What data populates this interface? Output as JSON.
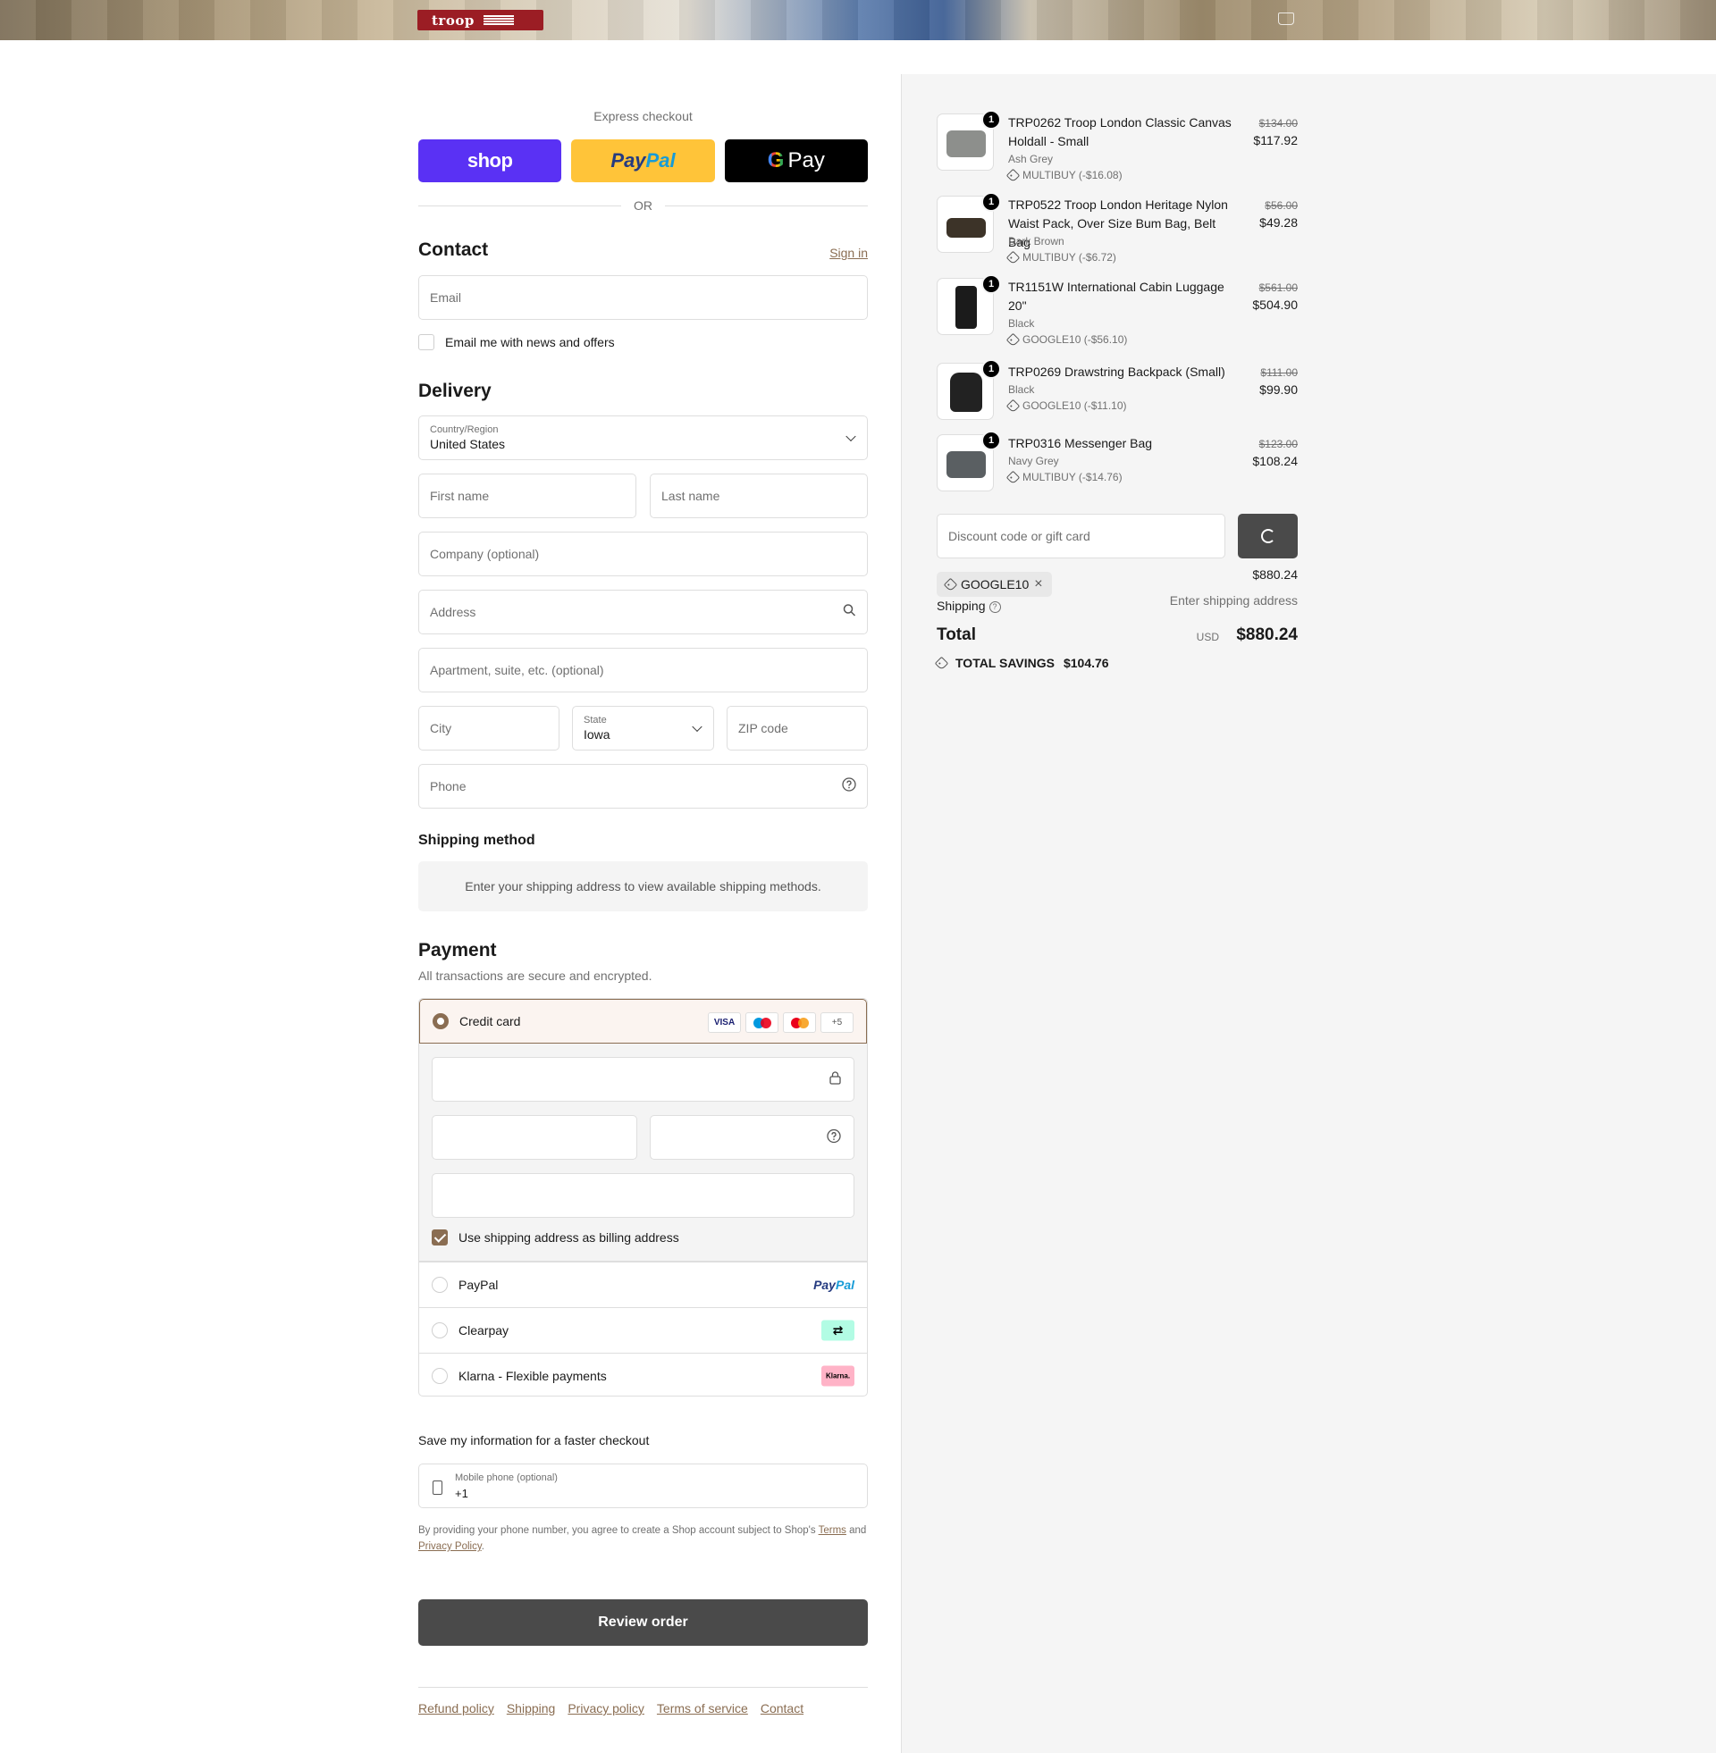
{
  "brand": {
    "logo_text": "troop"
  },
  "express": {
    "title": "Express checkout",
    "shop_label": "shop",
    "paypal_label_1": "Pay",
    "paypal_label_2": "Pal",
    "gpay_g": "G",
    "gpay_label": "Pay",
    "or_label": "OR"
  },
  "contact": {
    "title": "Contact",
    "sign_in": "Sign in",
    "email_placeholder": "Email",
    "news_label": "Email me with news and offers"
  },
  "delivery": {
    "title": "Delivery",
    "country_label": "Country/Region",
    "country_value": "United States",
    "first_name": "First name",
    "last_name": "Last name",
    "company": "Company (optional)",
    "address": "Address",
    "apartment": "Apartment, suite, etc. (optional)",
    "city": "City",
    "state_label": "State",
    "state_value": "Iowa",
    "zip": "ZIP code",
    "phone": "Phone"
  },
  "shipping_method": {
    "title": "Shipping method",
    "notice": "Enter your shipping address to view available shipping methods."
  },
  "payment": {
    "title": "Payment",
    "subtitle": "All transactions are secure and encrypted.",
    "credit_card": "Credit card",
    "brands": {
      "visa": "VISA",
      "more": "+5"
    },
    "billing_label": "Use shipping address as billing address",
    "paypal": "PayPal",
    "paypal_logo_1": "Pay",
    "paypal_logo_2": "Pal",
    "clearpay": "Clearpay",
    "clearpay_logo": "⇄",
    "klarna": "Klarna - Flexible payments",
    "klarna_logo": "Klarna."
  },
  "save_info": {
    "title": "Save my information for a faster checkout",
    "mobile_label": "Mobile phone (optional)",
    "mobile_value": "+1",
    "legal_1": "By providing your phone number, you agree to create a Shop account subject to Shop's",
    "terms": "Terms",
    "legal_2": "and",
    "privacy": "Privacy Policy",
    "legal_3": "."
  },
  "review_label": "Review order",
  "footer": [
    "Refund policy",
    "Shipping",
    "Privacy policy",
    "Terms of service",
    "Contact"
  ],
  "items": [
    {
      "qty": "1",
      "name": "TRP0262 Troop London Classic Canvas Holdall - Small",
      "variant": "Ash Grey",
      "discount": "MULTIBUY (-$16.08)",
      "old_price": "$134.00",
      "price": "$117.92",
      "color": "#8d8f8c"
    },
    {
      "qty": "1",
      "name": "TRP0522 Troop London Heritage Nylon Waist Pack, Over Size Bum Bag, Belt Bag",
      "variant": "Dark Brown",
      "discount": "MULTIBUY (-$6.72)",
      "old_price": "$56.00",
      "price": "$49.28",
      "color": "#3c3328"
    },
    {
      "qty": "1",
      "name": "TR1151W International Cabin Luggage 20\"",
      "variant": "Black",
      "discount": "GOOGLE10 (-$56.10)",
      "old_price": "$561.00",
      "price": "$504.90",
      "color": "#1b1b1b"
    },
    {
      "qty": "1",
      "name": "TRP0269 Drawstring Backpack (Small)",
      "variant": "Black",
      "discount": "GOOGLE10 (-$11.10)",
      "old_price": "$111.00",
      "price": "$99.90",
      "color": "#222222"
    },
    {
      "qty": "1",
      "name": "TRP0316 Messenger Bag",
      "variant": "Navy Grey",
      "discount": "MULTIBUY (-$14.76)",
      "old_price": "$123.00",
      "price": "$108.24",
      "color": "#5a5f62"
    }
  ],
  "summary": {
    "discount_placeholder": "Discount code or gift card",
    "subtotal_value": "$880.24",
    "code_chip": "GOOGLE10",
    "shipping_label": "Shipping",
    "shipping_value": "Enter shipping address",
    "total_label": "Total",
    "currency": "USD",
    "total_value": "$880.24",
    "savings_label": "TOTAL SAVINGS",
    "savings_value": "$104.76"
  }
}
